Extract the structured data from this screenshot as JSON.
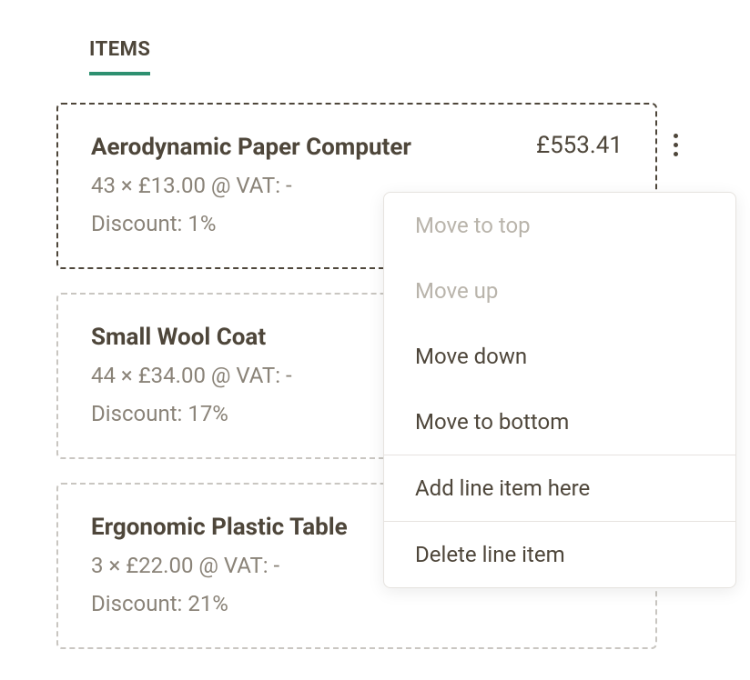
{
  "tabs": {
    "items": "ITEMS"
  },
  "items": [
    {
      "title": "Aerodynamic Paper Computer",
      "price": "£553.41",
      "subline": "43 × £13.00 @ VAT: -",
      "discount": "Discount: 1%",
      "selected": true
    },
    {
      "title": "Small Wool Coat",
      "price": "",
      "subline": "44 × £34.00 @ VAT: -",
      "discount": "Discount: 17%",
      "selected": false
    },
    {
      "title": "Ergonomic Plastic Table",
      "price": "",
      "subline": "3 × £22.00 @ VAT: -",
      "discount": "Discount: 21%",
      "selected": false
    }
  ],
  "menu": {
    "move_top": "Move to top",
    "move_up": "Move up",
    "move_down": "Move down",
    "move_bottom": "Move to bottom",
    "add_here": "Add line item here",
    "delete": "Delete line item"
  }
}
